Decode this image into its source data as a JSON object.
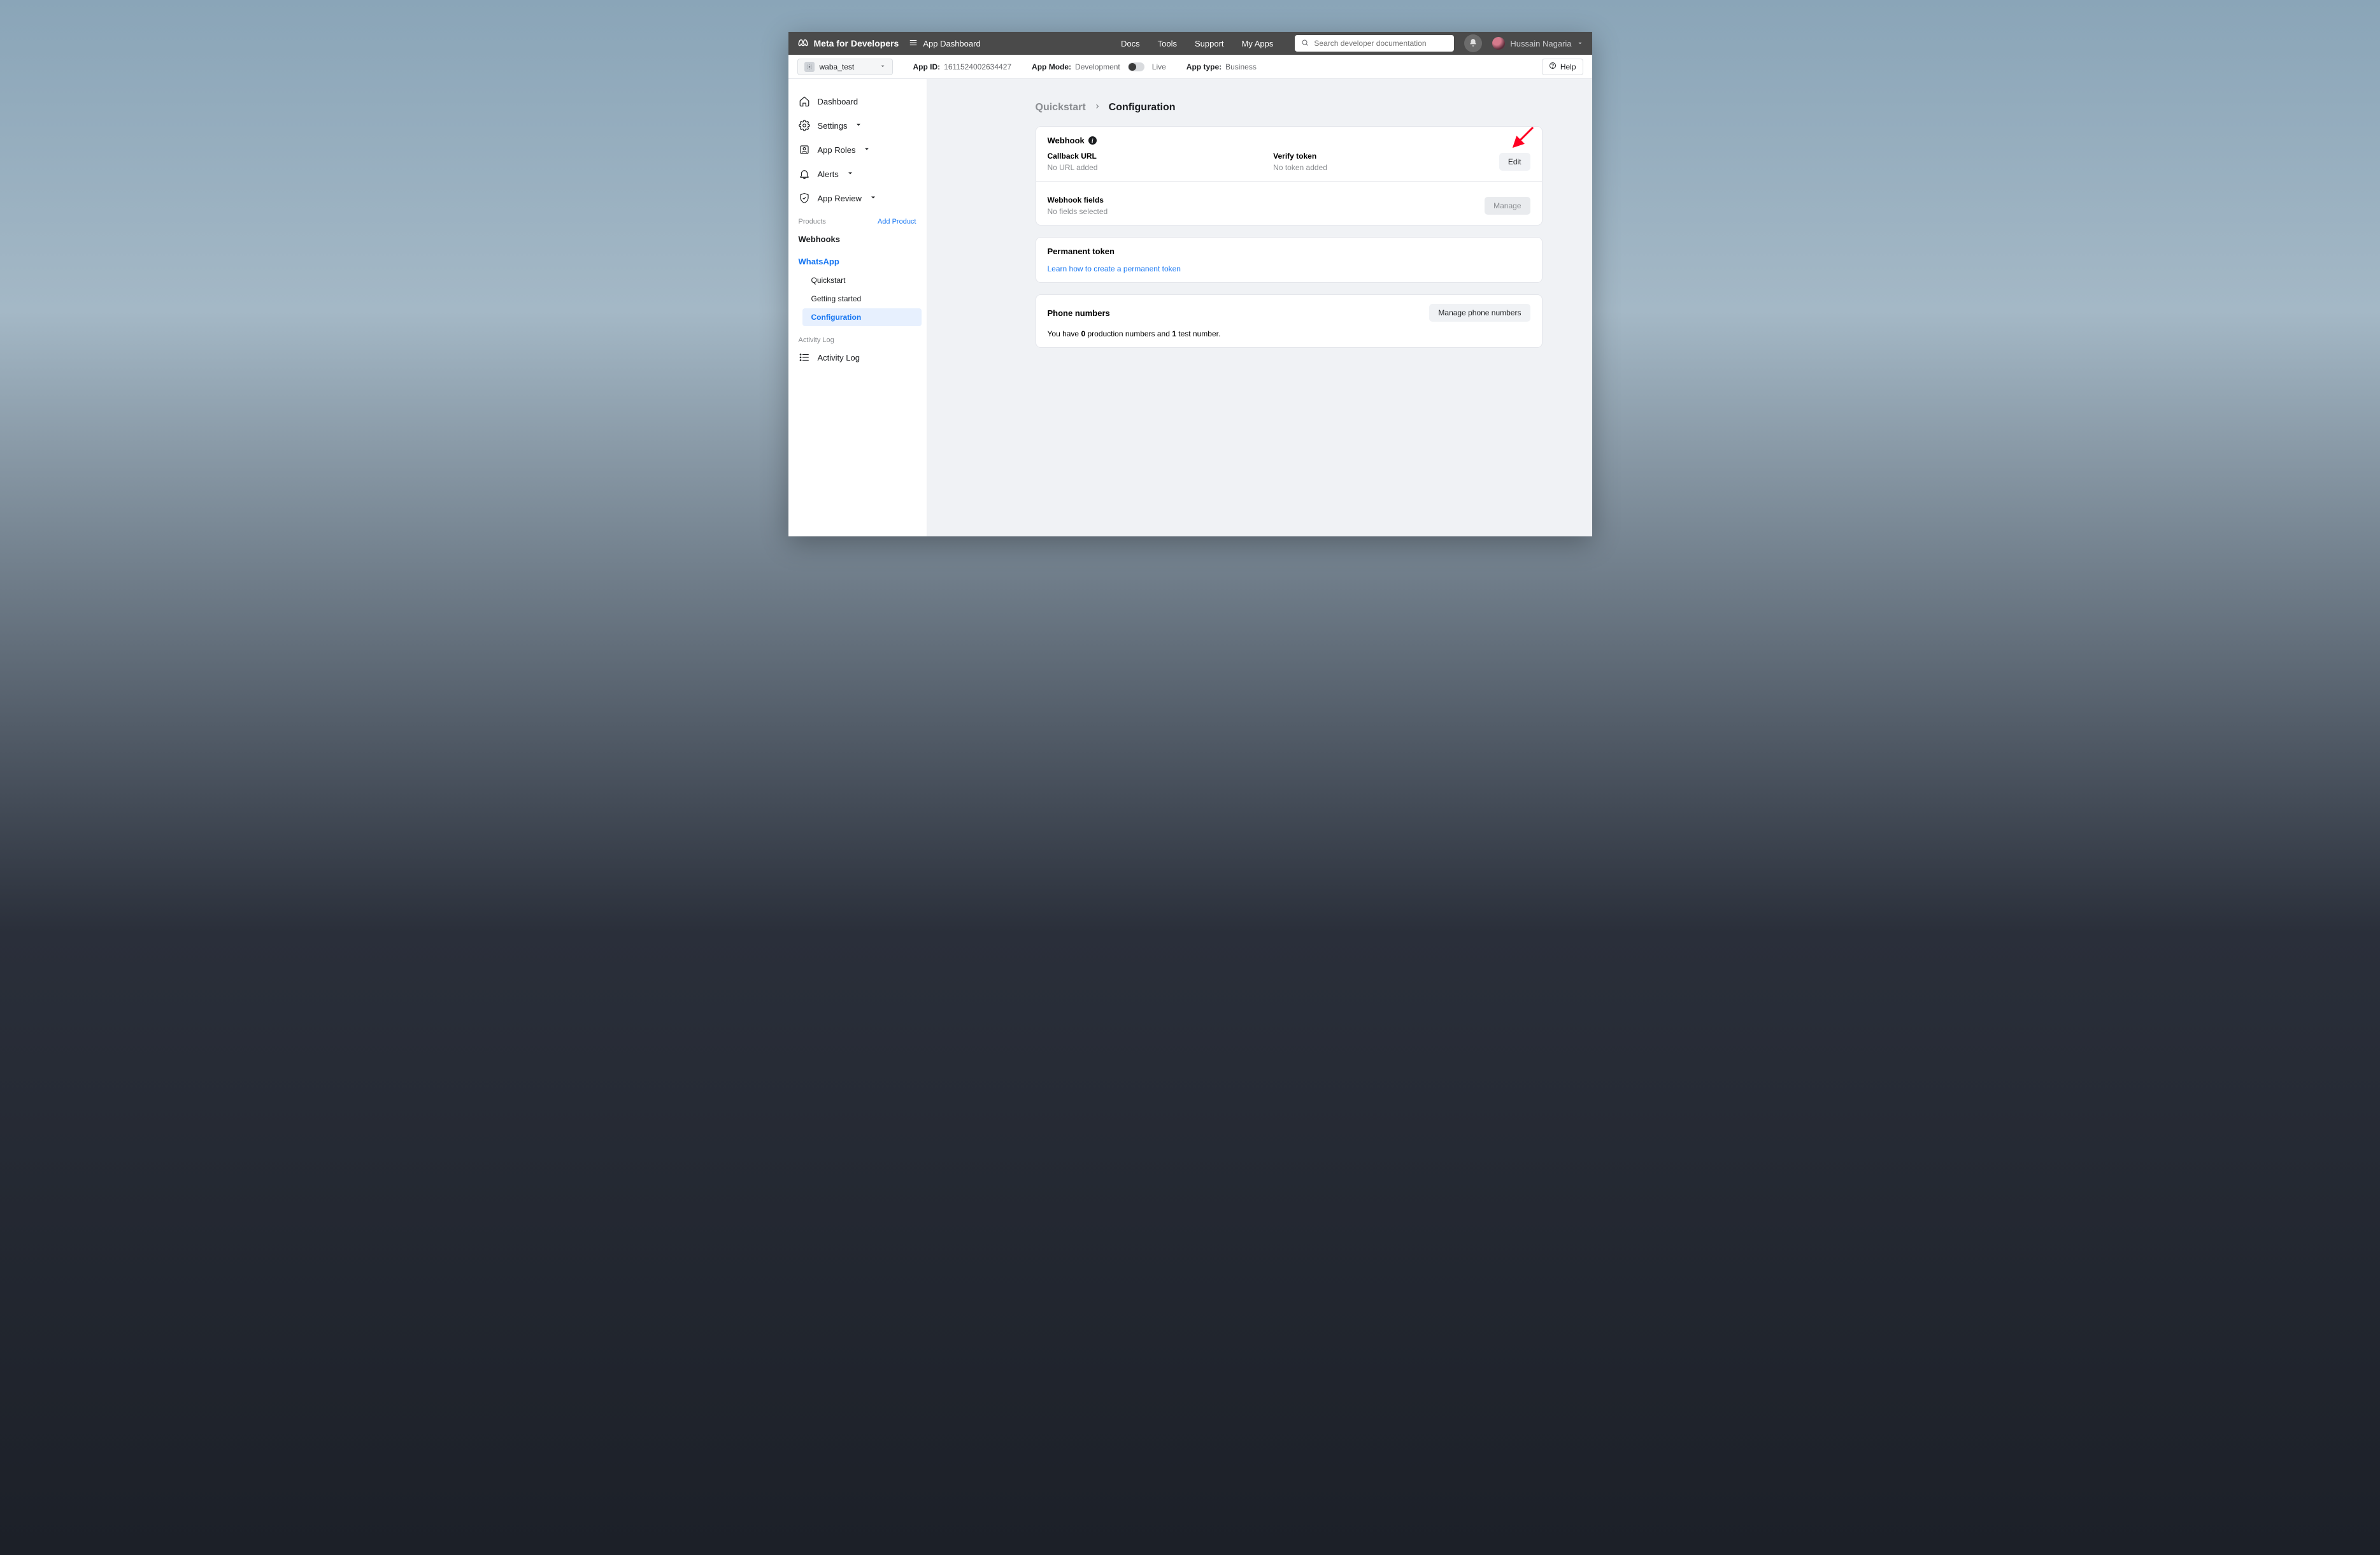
{
  "topbar": {
    "brand": "Meta for Developers",
    "dashboard_link": "App Dashboard",
    "nav": {
      "docs": "Docs",
      "tools": "Tools",
      "support": "Support",
      "my_apps": "My Apps"
    },
    "search_placeholder": "Search developer documentation",
    "user_name": "Hussain Nagaria"
  },
  "subheader": {
    "app_name": "waba_test",
    "app_id_label": "App ID:",
    "app_id": "1611524002634427",
    "app_mode_label": "App Mode:",
    "app_mode_dev": "Development",
    "app_mode_live": "Live",
    "app_type_label": "App type:",
    "app_type": "Business",
    "help": "Help"
  },
  "sidebar": {
    "dashboard": "Dashboard",
    "settings": "Settings",
    "app_roles": "App Roles",
    "alerts": "Alerts",
    "app_review": "App Review",
    "products_label": "Products",
    "add_product": "Add Product",
    "webhooks": "Webhooks",
    "whatsapp": "WhatsApp",
    "wa_quickstart": "Quickstart",
    "wa_getting_started": "Getting started",
    "wa_configuration": "Configuration",
    "activity_log_label": "Activity Log",
    "activity_log": "Activity Log"
  },
  "breadcrumb": {
    "parent": "Quickstart",
    "current": "Configuration"
  },
  "webhook": {
    "title": "Webhook",
    "callback_label": "Callback URL",
    "callback_value": "No URL added",
    "verify_label": "Verify token",
    "verify_value": "No token added",
    "edit": "Edit",
    "fields_label": "Webhook fields",
    "fields_value": "No fields selected",
    "manage": "Manage"
  },
  "permanent_token": {
    "title": "Permanent token",
    "link": "Learn how to create a permanent token"
  },
  "phone": {
    "title": "Phone numbers",
    "manage": "Manage phone numbers",
    "text_pre": "You have ",
    "text_prod_count": "0",
    "text_mid": " production numbers and ",
    "text_test_count": "1",
    "text_post": " test number."
  }
}
